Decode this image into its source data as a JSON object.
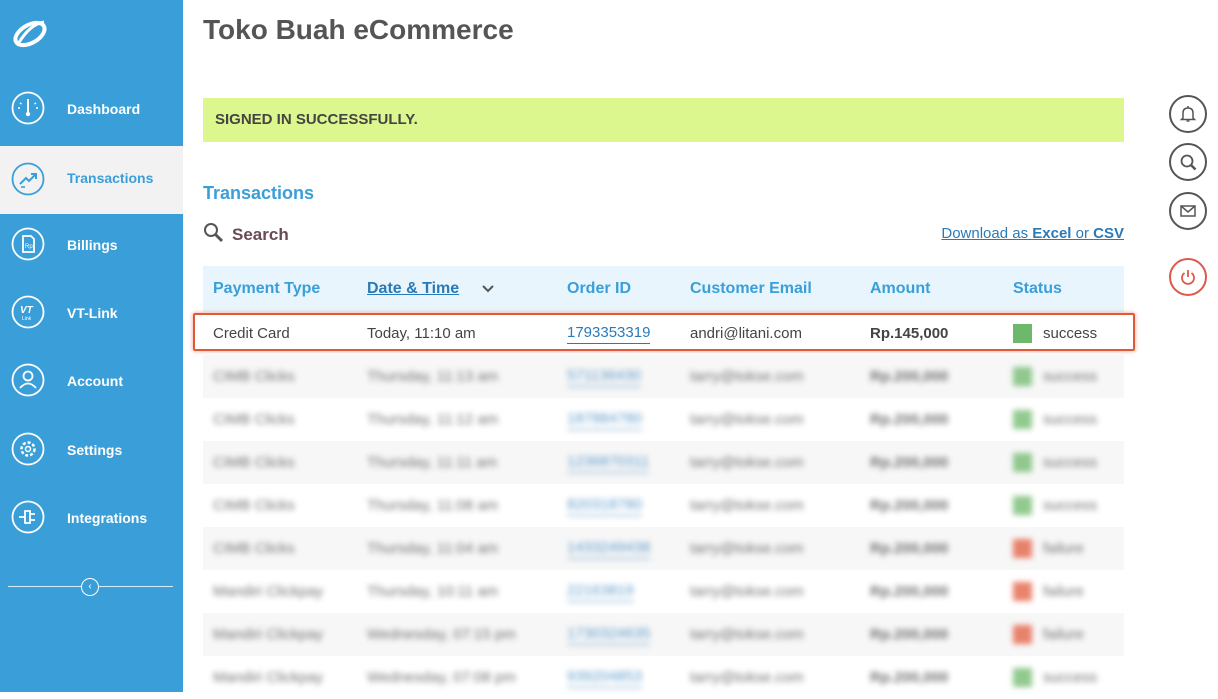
{
  "app": {
    "title": "Toko Buah eCommerce"
  },
  "sidebar": {
    "items": [
      {
        "label": "Dashboard",
        "icon": "gauge-icon"
      },
      {
        "label": "Transactions",
        "icon": "transactions-icon"
      },
      {
        "label": "Billings",
        "icon": "billing-document-icon"
      },
      {
        "label": "VT-Link",
        "icon": "vt-link-icon"
      },
      {
        "label": "Account",
        "icon": "user-icon"
      },
      {
        "label": "Settings",
        "icon": "gear-icon"
      },
      {
        "label": "Integrations",
        "icon": "plug-icon"
      }
    ],
    "active": "Transactions",
    "collapse_icon": "chevron-left-icon"
  },
  "alert": {
    "text": "SIGNED IN SUCCESSFULLY."
  },
  "transactions": {
    "title": "Transactions",
    "search_label": "Search",
    "download": {
      "prefix": "Download as ",
      "excel": "Excel",
      "or": " or ",
      "csv": "CSV"
    },
    "columns": [
      "Payment Type",
      "Date & Time",
      "Order ID",
      "Customer Email",
      "Amount",
      "Status"
    ],
    "sorted_column": "Date & Time",
    "rows": [
      {
        "payment_type": "Credit Card",
        "date_time": "Today, 11:10 am",
        "order_id": "1793353319",
        "email": "andri@litani.com",
        "amount": "Rp.145,000",
        "status": "success",
        "status_color": "#6db86a"
      },
      {
        "payment_type": "CIMB Clicks",
        "date_time": "Thursday, 11:13 am",
        "order_id": "571136430",
        "email": "tarry@tokse.com",
        "amount": "Rp.200,000",
        "status": "success",
        "status_color": "#6db86a"
      },
      {
        "payment_type": "CIMB Clicks",
        "date_time": "Thursday, 11:12 am",
        "order_id": "187884780",
        "email": "tarry@tokse.com",
        "amount": "Rp.200,000",
        "status": "success",
        "status_color": "#6db86a"
      },
      {
        "payment_type": "CIMB Clicks",
        "date_time": "Thursday, 11:11 am",
        "order_id": "1236870311",
        "email": "tarry@tokse.com",
        "amount": "Rp.200,000",
        "status": "success",
        "status_color": "#6db86a"
      },
      {
        "payment_type": "CIMB Clicks",
        "date_time": "Thursday, 11:08 am",
        "order_id": "820318780",
        "email": "tarry@tokse.com",
        "amount": "Rp.200,000",
        "status": "success",
        "status_color": "#6db86a"
      },
      {
        "payment_type": "CIMB Clicks",
        "date_time": "Thursday, 11:04 am",
        "order_id": "1433249438",
        "email": "tarry@tokse.com",
        "amount": "Rp.200,000",
        "status": "failure",
        "status_color": "#e25a3c"
      },
      {
        "payment_type": "Mandiri Clickpay",
        "date_time": "Thursday, 10:11 am",
        "order_id": "22163819",
        "email": "tarry@tokse.com",
        "amount": "Rp.200,000",
        "status": "failure",
        "status_color": "#e25a3c"
      },
      {
        "payment_type": "Mandiri Clickpay",
        "date_time": "Wednesday, 07:15 pm",
        "order_id": "1730324635",
        "email": "tarry@tokse.com",
        "amount": "Rp.200,000",
        "status": "failure",
        "status_color": "#e25a3c"
      },
      {
        "payment_type": "Mandiri Clickpay",
        "date_time": "Wednesday, 07:08 pm",
        "order_id": "939204853",
        "email": "tarry@tokse.com",
        "amount": "Rp.200,000",
        "status": "success",
        "status_color": "#6db86a"
      }
    ],
    "highlighted_row": "1793353319"
  },
  "toolbar": {
    "icons": [
      "bell-icon",
      "search-icon",
      "mail-icon",
      "power-icon"
    ]
  }
}
